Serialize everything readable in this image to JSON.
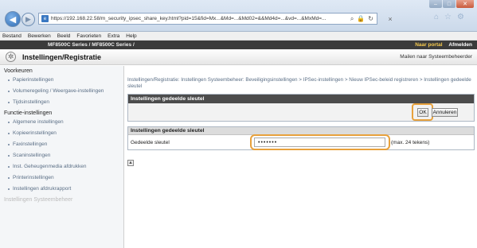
{
  "browser": {
    "url": "https://192.168.22.58/m_security_ipsec_share_key.html?pid=15&fid=Mx...&Md=...&Md02=&&Md4d=...&vd=...&MxMd=...",
    "tab_close": "×",
    "icons": [
      "back-icon",
      "forward-icon",
      "search-icon",
      "lock-icon",
      "refresh-icon",
      "close-icon",
      "home-icon",
      "star-icon",
      "gear-icon"
    ]
  },
  "menu": [
    "Bestand",
    "Bewerken",
    "Beeld",
    "Favorieten",
    "Extra",
    "Help"
  ],
  "strip": {
    "left": "MF8500C Series / MF8500C Series /",
    "portal": "Naar portal",
    "logout": "Afmelden"
  },
  "header": {
    "title": "Instellingen/Registratie",
    "mail_admin": "Mailen naar Systeembeheerder"
  },
  "sidebar": {
    "section1": "Voorkeuren",
    "items1": [
      "Papierinstellingen",
      "Volumeregeling / Weergave-instellingen",
      "Tijdsinstellingen"
    ],
    "section2": "Functie-instellingen",
    "items2": [
      "Algemene instellingen",
      "Kopieerinstellingen",
      "Faxinstellingen",
      "Scaninstellingen",
      "Inst. Geheugenmedia afdrukken",
      "Printerinstellingen",
      "Instellingen afdrukrapport"
    ],
    "section3": "Instellingen Systeembeheer"
  },
  "main": {
    "breadcrumb": "Instellingen/Registratie: Instellingen Systeembeheer: Beveiligingsinstellingen > IPSec-instellingen > Nieuw IPSec-beleid registreren > Instellingen gedeelde sleutel",
    "panel_title": "Instellingen gedeelde sleutel",
    "ok_label": "OK",
    "cancel_label": "Annuleren",
    "sub_title": "Instellingen gedeelde sleutel",
    "field_label": "Gedeelde sleutel",
    "field_value": "•••••••",
    "field_hint": "(max. 24 tekens)"
  },
  "colors": {
    "highlight": "#e8a13c",
    "dark_header": "#4c4c4c",
    "link": "#5a6e85"
  }
}
